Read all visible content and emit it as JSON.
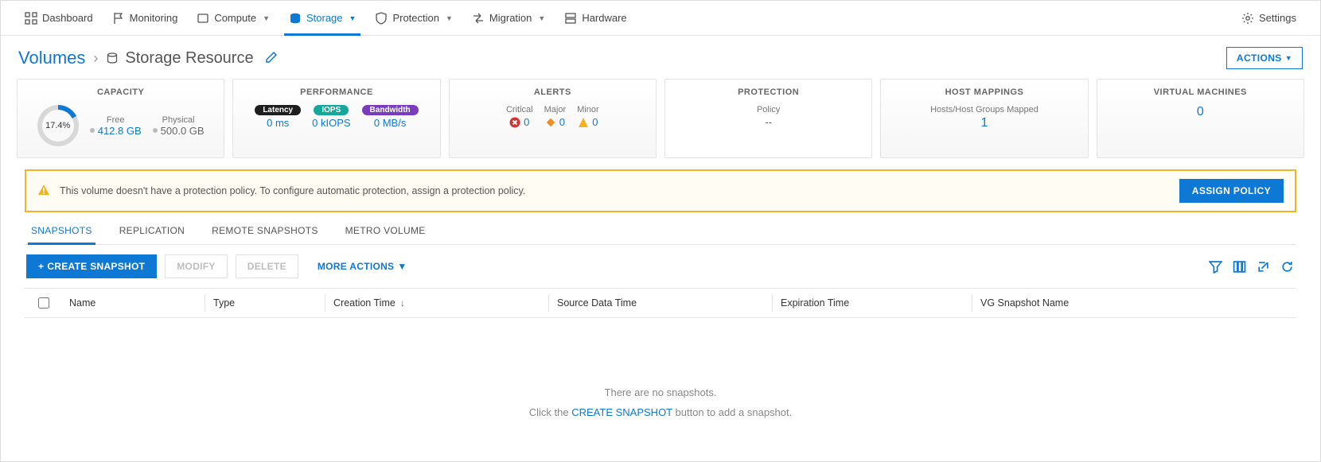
{
  "nav": {
    "items": [
      {
        "label": "Dashboard"
      },
      {
        "label": "Monitoring"
      },
      {
        "label": "Compute",
        "dropdown": true
      },
      {
        "label": "Storage",
        "dropdown": true,
        "active": true
      },
      {
        "label": "Protection",
        "dropdown": true
      },
      {
        "label": "Migration",
        "dropdown": true
      },
      {
        "label": "Hardware"
      }
    ],
    "settings": "Settings"
  },
  "breadcrumb": {
    "root": "Volumes",
    "current": "Storage Resource"
  },
  "actions_button": "ACTIONS",
  "cards": {
    "capacity": {
      "title": "CAPACITY",
      "pct": "17.4%",
      "free_label": "Free",
      "free_val": "412.8 GB",
      "phys_label": "Physical",
      "phys_val": "500.0 GB"
    },
    "performance": {
      "title": "PERFORMANCE",
      "latency": {
        "pill": "Latency",
        "val": "0 ms"
      },
      "iops": {
        "pill": "IOPS",
        "val": "0 kIOPS"
      },
      "bw": {
        "pill": "Bandwidth",
        "val": "0 MB/s"
      }
    },
    "alerts": {
      "title": "ALERTS",
      "critical": {
        "label": "Critical",
        "val": "0"
      },
      "major": {
        "label": "Major",
        "val": "0"
      },
      "minor": {
        "label": "Minor",
        "val": "0"
      }
    },
    "protection": {
      "title": "PROTECTION",
      "policy_label": "Policy",
      "policy_val": "--"
    },
    "host": {
      "title": "HOST MAPPINGS",
      "label": "Hosts/Host Groups Mapped",
      "val": "1"
    },
    "vm": {
      "title": "VIRTUAL MACHINES",
      "val": "0"
    }
  },
  "banner": {
    "msg": "This volume doesn't have a protection policy. To configure automatic protection, assign a protection policy.",
    "button": "ASSIGN POLICY"
  },
  "subtabs": [
    "SNAPSHOTS",
    "REPLICATION",
    "REMOTE SNAPSHOTS",
    "METRO VOLUME"
  ],
  "toolbar": {
    "create": "CREATE SNAPSHOT",
    "modify": "MODIFY",
    "delete": "DELETE",
    "more": "MORE ACTIONS"
  },
  "columns": {
    "name": "Name",
    "type": "Type",
    "ctime": "Creation Time",
    "sdt": "Source Data Time",
    "exp": "Expiration Time",
    "vgs": "VG Snapshot Name"
  },
  "empty": {
    "line1": "There are no snapshots.",
    "pre": "Click the ",
    "link": "CREATE SNAPSHOT",
    "post": " button to add a snapshot."
  }
}
